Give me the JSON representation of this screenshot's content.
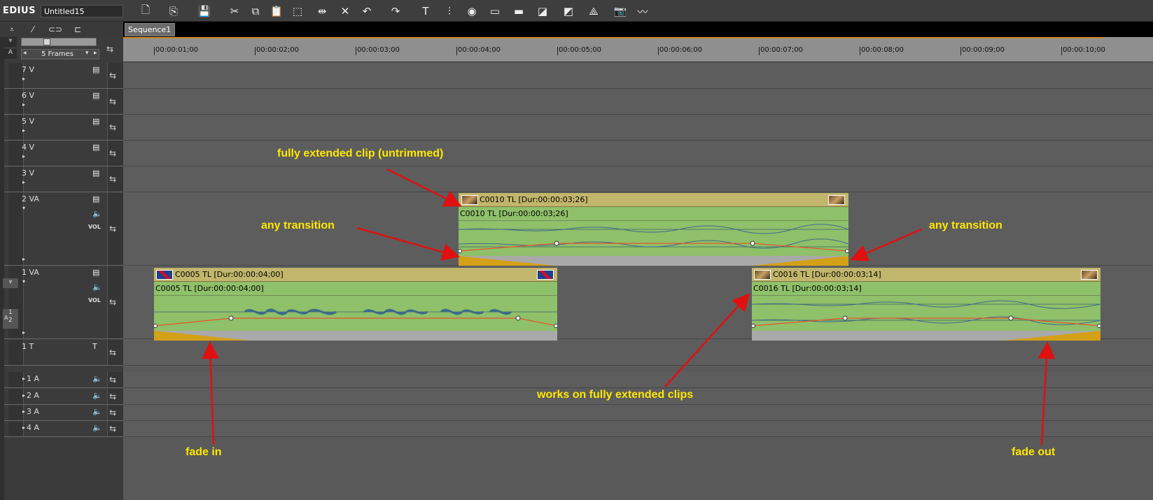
{
  "app": {
    "name": "EDIUS",
    "project": "Untitled15"
  },
  "toolbar": {
    "buttons": [
      {
        "name": "new-icon",
        "glyph": "🗋",
        "dd": true
      },
      {
        "name": "open-icon",
        "glyph": "⎘",
        "dd": true
      },
      {
        "name": "save-icon",
        "glyph": "💾",
        "dd": true
      },
      {
        "name": "cut-icon",
        "glyph": "✂",
        "dd": false
      },
      {
        "name": "copy-icon",
        "glyph": "⧉",
        "dd": false
      },
      {
        "name": "paste-icon",
        "glyph": "📋",
        "dd": false
      },
      {
        "name": "replace-icon",
        "glyph": "⬚",
        "dd": true
      },
      {
        "name": "ripple-delete-icon",
        "glyph": "⇹",
        "dd": false
      },
      {
        "name": "delete-icon",
        "glyph": "✕",
        "dd": false
      },
      {
        "name": "undo-icon",
        "glyph": "↶",
        "dd": true
      },
      {
        "name": "redo-icon",
        "glyph": "↷",
        "dd": true
      },
      {
        "name": "title-icon",
        "glyph": "T",
        "dd": true
      },
      {
        "name": "mixer-icon",
        "glyph": "⫶",
        "dd": false
      },
      {
        "name": "color-icon",
        "glyph": "◉",
        "dd": false
      },
      {
        "name": "render-icon",
        "glyph": "▭",
        "dd": false
      },
      {
        "name": "marker-icon",
        "glyph": "▬",
        "dd": false
      },
      {
        "name": "trim-icon",
        "glyph": "◪",
        "dd": true
      },
      {
        "name": "export-icon",
        "glyph": "◩",
        "dd": true
      },
      {
        "name": "effects-icon",
        "glyph": "⟁",
        "dd": false
      },
      {
        "name": "snapshot-icon",
        "glyph": "📷",
        "dd": false
      },
      {
        "name": "waveform-icon",
        "glyph": "〰",
        "dd": false
      }
    ]
  },
  "left_header": {
    "zoom_label": "5 Frames"
  },
  "sequence": {
    "tab": "Sequence1"
  },
  "ruler": {
    "ticks": [
      "00:00:01;00",
      "00:00:02;00",
      "00:00:03;00",
      "00:00:04;00",
      "00:00:05;00",
      "00:00:06;00",
      "00:00:07;00",
      "00:00:08;00",
      "00:00:09;00",
      "00:00:10;00"
    ]
  },
  "tracks": [
    {
      "name": "7 V",
      "type": "V"
    },
    {
      "name": "6 V",
      "type": "V"
    },
    {
      "name": "5 V",
      "type": "V"
    },
    {
      "name": "4 V",
      "type": "V"
    },
    {
      "name": "3 V",
      "type": "V"
    },
    {
      "name": "2 VA",
      "type": "VA",
      "vol": "VOL"
    },
    {
      "name": "1 VA",
      "type": "VA",
      "vol": "VOL",
      "side": "1\n2",
      "side_a": "A"
    },
    {
      "name": "1 T",
      "type": "T"
    },
    {
      "name": "1 A",
      "type": "A"
    },
    {
      "name": "2 A",
      "type": "A"
    },
    {
      "name": "3 A",
      "type": "A"
    },
    {
      "name": "4 A",
      "type": "A"
    }
  ],
  "clips": {
    "c0010": {
      "head": "C0010  TL [Dur:00:00:03;26]",
      "sub": "C0010  TL [Dur:00:00:03;26]"
    },
    "c0005": {
      "head": "C0005  TL [Dur:00:00:04;00]",
      "sub": "C0005  TL [Dur:00:00:04;00]"
    },
    "c0016": {
      "head": "C0016  TL [Dur:00:00:03;14]",
      "sub": "C0016  TL [Dur:00:00:03;14]"
    }
  },
  "annotations": {
    "fully_extended": "fully extended clip (untrimmed)",
    "any_transition_left": "any transition",
    "any_transition_right": "any transition",
    "works_on": "works on fully extended clips",
    "fade_in": "fade in",
    "fade_out": "fade out"
  },
  "colors": {
    "annotation": "#ffe800",
    "arrow": "#e01010",
    "clip_head": "#c2b66c",
    "clip_body": "#8fc06a",
    "transition": "#d4a017"
  }
}
